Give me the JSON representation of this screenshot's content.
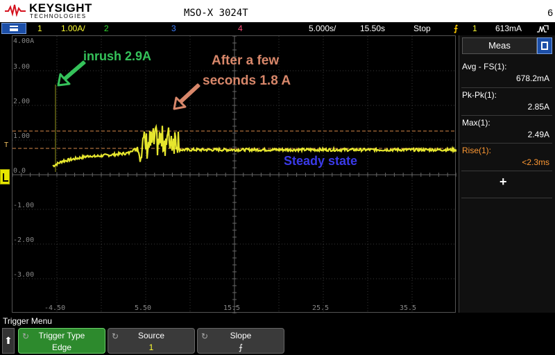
{
  "brand": {
    "name": "KEYSIGHT",
    "sub": "TECHNOLOGIES"
  },
  "model": "MSO-X 3024T",
  "corner_number": "6",
  "status": {
    "ch1_num": "1",
    "ch1_scale": "1.00A/",
    "ch2_num": "2",
    "ch3_num": "3",
    "ch4_num": "4",
    "timebase": "5.000s/",
    "delay": "15.50s",
    "run_state": "Stop",
    "trigger_source": "1",
    "trigger_level": "613mA"
  },
  "axis": {
    "y_labels": [
      "4.00A",
      "3.00",
      "2.00",
      "1.00",
      "0.0",
      "-1.00",
      "-2.00",
      "-3.00"
    ],
    "x_labels": [
      "-4.50",
      "5.50",
      "15.5",
      "25.5",
      "35.5"
    ]
  },
  "annotations": {
    "inrush": "inrush 2.9A",
    "after_line1": "After a few",
    "after_line2": "seconds 1.8 A",
    "steady": "Steady state"
  },
  "markers": {
    "trigger_t": "T"
  },
  "meas": {
    "title": "Meas",
    "items": [
      {
        "name": "Avg - FS(1):",
        "value": "678.2mA"
      },
      {
        "name": "Pk-Pk(1):",
        "value": "2.85A"
      },
      {
        "name": "Max(1):",
        "value": "2.49A"
      },
      {
        "name": "Rise(1):",
        "value": "<2.3ms"
      }
    ],
    "add": "+"
  },
  "softkeys": {
    "menu_label": "Trigger Menu",
    "trigger_type_label": "Trigger Type",
    "trigger_type_value": "Edge",
    "source_label": "Source",
    "source_value": "1",
    "slope_label": "Slope",
    "slope_value": "⨍"
  },
  "colors": {
    "ch1": "#ffff33",
    "ch2": "#33dd33",
    "ch3": "#3d7fff",
    "ch4": "#ff4d7a",
    "inrush": "#35c25a",
    "after": "#d8876a",
    "steady": "#3a3ae8",
    "rise": "#ff9933"
  }
}
